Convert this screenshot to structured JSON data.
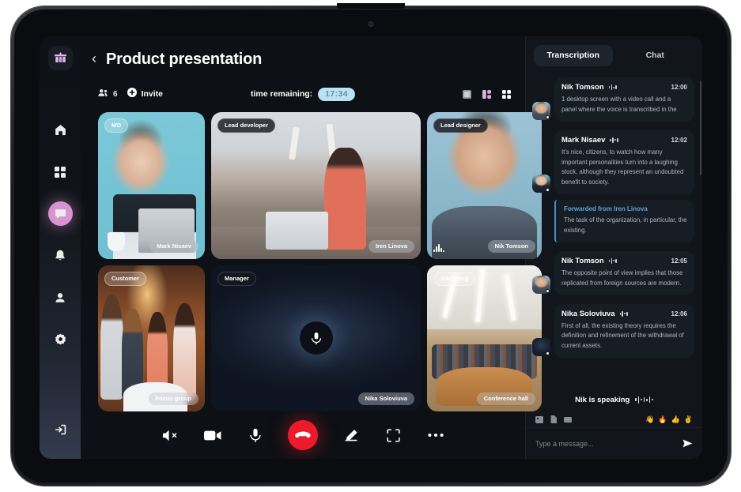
{
  "app": {
    "logo_icon": "app-logo-icon",
    "brand_color": "#d9b8ec"
  },
  "header": {
    "back_icon": "chevron-left-icon",
    "title": "Product presentation"
  },
  "toolbar": {
    "participants_icon": "people-icon",
    "participants_count": "6",
    "invite_icon": "plus-circle-icon",
    "invite_label": "Invite",
    "time_label": "time remaining:",
    "time_value": "17:34",
    "time_pill_bg": "#b9e3f2",
    "time_pill_fg": "#5e93aa",
    "layouts": [
      {
        "name": "layout-single-icon",
        "active": false
      },
      {
        "name": "layout-split-icon",
        "active": true
      },
      {
        "name": "layout-grid-icon",
        "active": false
      }
    ]
  },
  "sidebar": {
    "items": [
      {
        "name": "sidebar-item-home",
        "icon": "home-icon",
        "active": false
      },
      {
        "name": "sidebar-item-dashboard",
        "icon": "grid-icon",
        "active": false
      },
      {
        "name": "sidebar-item-chat",
        "icon": "chat-bubble-icon",
        "active": true
      },
      {
        "name": "sidebar-item-notifications",
        "icon": "bell-icon",
        "active": false
      },
      {
        "name": "sidebar-item-profile",
        "icon": "user-icon",
        "active": false
      },
      {
        "name": "sidebar-item-settings",
        "icon": "gear-icon",
        "active": false
      }
    ],
    "logout": {
      "name": "sidebar-item-logout",
      "icon": "logout-icon"
    },
    "active_color": "#e89fe0"
  },
  "video_tiles": [
    {
      "badge": "MO",
      "name": "Mark Nisaev",
      "speaking": false,
      "muted_display": false
    },
    {
      "badge": "Lead developer",
      "name": "Iren Linova",
      "speaking": false,
      "muted_display": false
    },
    {
      "badge": "Lead designer",
      "name": "Nik Tomson",
      "speaking": true,
      "muted_display": false
    },
    {
      "badge": "Customer",
      "name": "Focus group",
      "speaking": false,
      "muted_display": false
    },
    {
      "badge": "Manager",
      "name": "Nika Soloviuva",
      "speaking": false,
      "muted_display": true
    },
    {
      "badge": "Marketing",
      "name": "Conference hall",
      "speaking": false,
      "muted_display": false
    }
  ],
  "call_controls": [
    {
      "name": "speaker-mute-button",
      "icon": "speaker-mute-icon"
    },
    {
      "name": "camera-button",
      "icon": "video-camera-icon"
    },
    {
      "name": "microphone-button",
      "icon": "microphone-icon"
    },
    {
      "name": "end-call-button",
      "icon": "phone-hangup-icon",
      "color": "#ec1a2b"
    },
    {
      "name": "draw-button",
      "icon": "pen-icon"
    },
    {
      "name": "fullscreen-button",
      "icon": "focus-frame-icon"
    },
    {
      "name": "more-options-button",
      "icon": "ellipsis-icon"
    }
  ],
  "panel": {
    "tabs": [
      {
        "label": "Transcription",
        "active": true
      },
      {
        "label": "Chat",
        "active": false
      }
    ],
    "messages": [
      {
        "author": "Nik Tomson",
        "time": "12:00",
        "text": "1 desktop screen with a video call and a panel where the voice is transcribed in the",
        "avatar": "av-nik"
      },
      {
        "author": "Mark Nisaev",
        "time": "12:02",
        "text": "It's nice, citizens, to watch how many important personalities turn into a laughing stock, although they represent an undoubted benefit to society.",
        "avatar": "av-mark"
      },
      {
        "author": "Nik Tomson",
        "time": "12:05",
        "text": "The opposite point of view implies that those replicated from foreign sources are modern.",
        "avatar": "av-nik"
      },
      {
        "author": "Nika Soloviuva",
        "time": "12:06",
        "text": "First of all, the existing theory requires the definition and refinement of the withdrawal of current assets.",
        "avatar": "av-nika"
      }
    ],
    "forwarded": {
      "title": "Forwarded from Iren Linova",
      "text": "The task of the organization, in particular, the existing.",
      "accent": "#4a90c4"
    },
    "speaking_status": "Nik is speaking",
    "compose_tools": [
      {
        "name": "attach-image-icon"
      },
      {
        "name": "attach-file-icon"
      },
      {
        "name": "attach-clip-icon"
      }
    ],
    "reactions": [
      "👋",
      "🔥",
      "👍",
      "✌️"
    ],
    "input_placeholder": "Type a message...",
    "input_value": "",
    "send_icon": "send-icon"
  }
}
